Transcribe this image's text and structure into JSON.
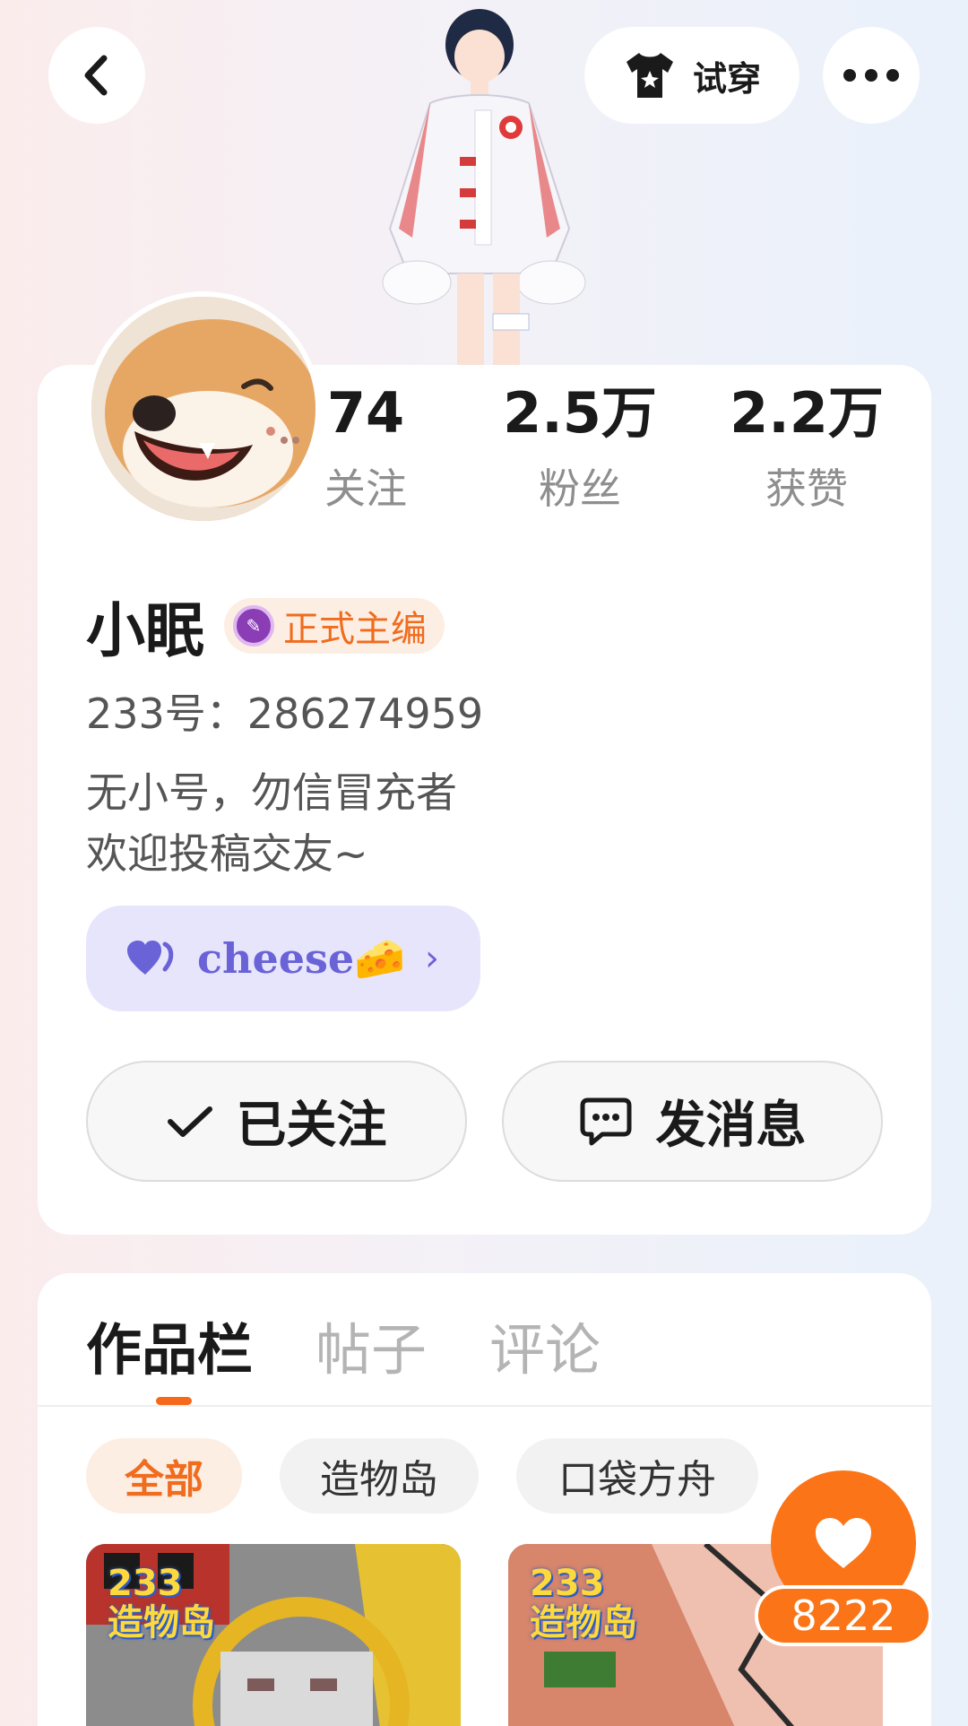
{
  "header": {
    "tryon_label": "试穿"
  },
  "stats": [
    {
      "value": "74",
      "label": "关注"
    },
    {
      "value": "2.5万",
      "label": "粉丝"
    },
    {
      "value": "2.2万",
      "label": "获赞"
    }
  ],
  "profile": {
    "name": "小眠",
    "badge_label": "正式主编",
    "uid": "233号：286274959",
    "bio_line1": "无小号，勿信冒充者",
    "bio_line2": "欢迎投稿交友~",
    "group_name": "cheese",
    "group_emoji": "🧀"
  },
  "actions": {
    "follow_label": "已关注",
    "message_label": "发消息"
  },
  "tabs": [
    {
      "label": "作品栏",
      "active": true
    },
    {
      "label": "帖子",
      "active": false
    },
    {
      "label": "评论",
      "active": false
    }
  ],
  "filters": [
    {
      "label": "全部",
      "active": true
    },
    {
      "label": "造物岛",
      "active": false
    },
    {
      "label": "口袋方舟",
      "active": false
    }
  ],
  "works": [
    {
      "logo_line1": "233",
      "logo_line2": "造物岛"
    },
    {
      "logo_line1": "233",
      "logo_line2": "造物岛"
    }
  ],
  "like_fab": {
    "count": "8222"
  },
  "colors": {
    "accent": "#f56a1a",
    "group_purple": "#6a63d8"
  }
}
